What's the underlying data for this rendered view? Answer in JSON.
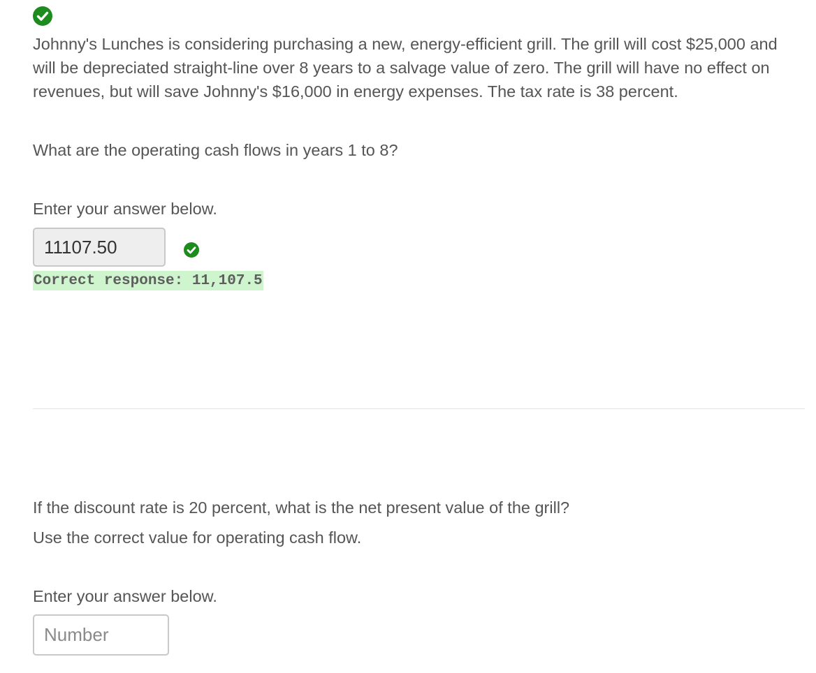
{
  "problem": {
    "text": "Johnny's Lunches is considering purchasing a new, energy-efficient grill. The grill will cost $25,000 and will be depreciated straight-line over 8 years to a salvage value of zero. The grill will have no effect on revenues, but will save Johnny's $16,000 in energy expenses. The tax rate is 38 percent.",
    "status_icon": "check-circle-icon"
  },
  "question1": {
    "prompt": "What are the operating cash flows in years 1 to 8?",
    "enter_label": "Enter your answer below.",
    "answer_value": "11107.50",
    "answer_status_icon": "check-circle-icon",
    "correct_response": "Correct response: 11,107.5"
  },
  "question2": {
    "prompt": "If the discount rate is 20 percent, what is the net present value of the grill?",
    "note": "Use the correct value for operating cash flow.",
    "enter_label": "Enter your answer below.",
    "input_placeholder": "Number",
    "input_value": ""
  },
  "colors": {
    "success_green": "#1e8b1e",
    "correct_highlight": "#cff5cf",
    "text_gray": "#555555"
  }
}
